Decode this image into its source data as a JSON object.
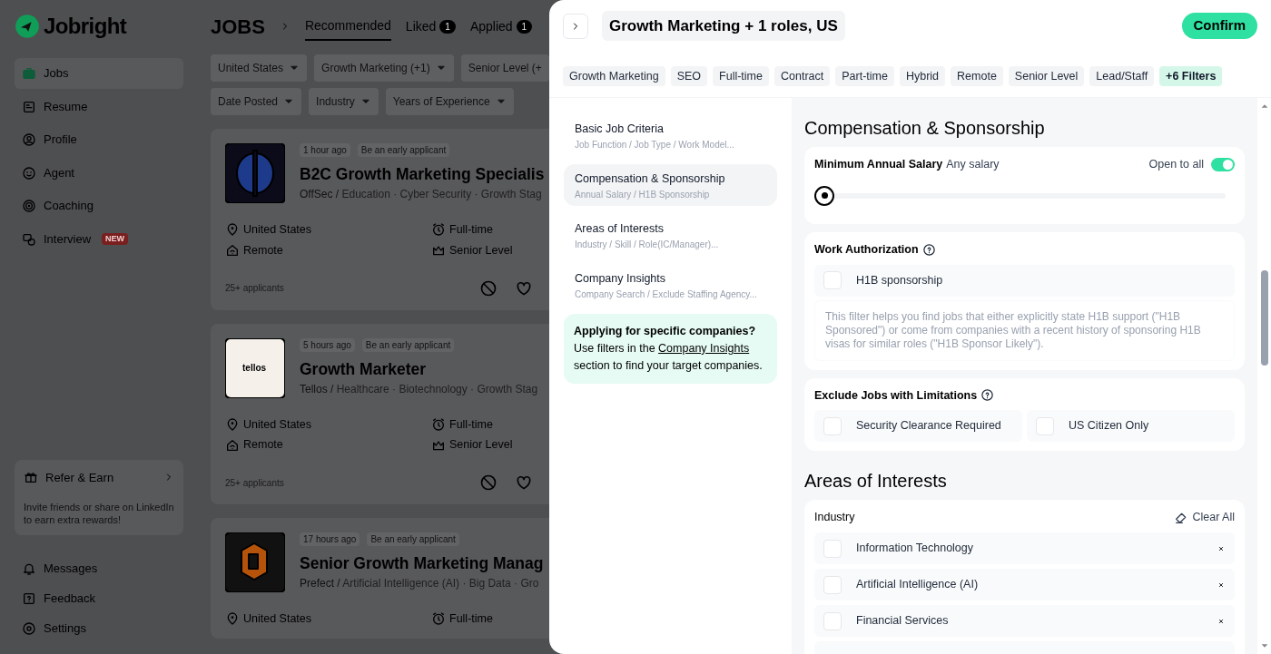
{
  "app": {
    "logo": "Jobright"
  },
  "sidebar": {
    "items": [
      {
        "label": "Jobs",
        "selected": true
      },
      {
        "label": "Resume",
        "selected": false
      },
      {
        "label": "Profile",
        "selected": false
      },
      {
        "label": "Agent",
        "selected": false
      },
      {
        "label": "Coaching",
        "selected": false
      },
      {
        "label": "Interview",
        "selected": false,
        "badge": "NEW"
      }
    ],
    "refer": {
      "title": "Refer & Earn",
      "text": "Invite friends or share on LinkedIn to earn extra rewards!"
    },
    "bottom_items": [
      "Messages",
      "Feedback",
      "Settings"
    ]
  },
  "header": {
    "title": "JOBS",
    "tabs": [
      {
        "label": "Recommended",
        "selected": true
      },
      {
        "label": "Liked",
        "selected": false,
        "count": "1"
      },
      {
        "label": "Applied",
        "selected": false,
        "count": "1"
      }
    ]
  },
  "filter_rows": [
    [
      "United States",
      "Growth Marketing (+1)",
      "Senior Level (+"
    ],
    [
      "Date Posted",
      "Industry",
      "Years of Experience"
    ]
  ],
  "jobs": [
    {
      "posted": "1 hour ago",
      "note": "Be an early applicant",
      "title": "B2C Growth Marketing Specialis",
      "company": "OffSec /",
      "industries": "Education · Cyber Security · Growth Stag",
      "location": "United States",
      "job_type": "Full-time",
      "work_model": "Remote",
      "level": "Senior Level",
      "applicants": "25+ applicants",
      "liked": false
    },
    {
      "posted": "5 hours ago",
      "note": "Be an early applicant",
      "title": "Growth Marketer",
      "company": "Tellos /",
      "industries": "Healthcare · Biotechnology · Growth Stag",
      "location": "United States",
      "job_type": "Full-time",
      "work_model": "Remote",
      "level": "Senior Level",
      "applicants": "25+ applicants",
      "liked": false,
      "logo_text": "tellos"
    },
    {
      "posted": "17 hours ago",
      "note": "Be an early applicant",
      "title": "Senior Growth Marketing Manag",
      "company": "Prefect /",
      "industries": "Artificial Intelligence (AI) · Big Data · Gro",
      "location": "United States",
      "job_type": "Full-time"
    }
  ],
  "drawer": {
    "title": "Growth Marketing + 1 roles, US",
    "confirm": "Confirm",
    "chips": [
      {
        "label": "Growth Marketing",
        "kind": "filter"
      },
      {
        "label": "SEO",
        "kind": "filter"
      },
      {
        "label": "Full-time",
        "kind": "filter"
      },
      {
        "label": "Contract",
        "kind": "filter"
      },
      {
        "label": "Part-time",
        "kind": "filter"
      },
      {
        "label": "Hybrid",
        "kind": "filter"
      },
      {
        "label": "Remote",
        "kind": "filter"
      },
      {
        "label": "Senior Level",
        "kind": "filter"
      },
      {
        "label": "Lead/Staff",
        "kind": "filter"
      },
      {
        "label": "+6 Filters",
        "kind": "more"
      }
    ],
    "sections": [
      {
        "title": "Basic Job Criteria",
        "subtitle": "Job Function / Job Type / Work Model...",
        "selected": false
      },
      {
        "title": "Compensation & Sponsorship",
        "subtitle": "Annual Salary / H1B Sponsorship",
        "selected": true
      },
      {
        "title": "Areas of Interests",
        "subtitle": "Industry / Skill / Role(IC/Manager)...",
        "selected": false
      },
      {
        "title": "Company Insights",
        "subtitle": "Company Search / Exclude Staffing Agency...",
        "selected": false
      }
    ],
    "tip": {
      "title": "Applying for specific companies?",
      "before": "Use filters in the",
      "link": "Company Insights",
      "after": "section to find your target companies."
    },
    "compensation": {
      "heading": "Compensation & Sponsorship",
      "salary_label": "Minimum Annual Salary",
      "salary_value": "Any salary",
      "open_label": "Open to all",
      "open_on": true
    },
    "work_authorization": {
      "title": "Work Authorization",
      "option": {
        "label": "H1B sponsorship",
        "checked": false
      },
      "note": "This filter helps you find jobs that either explicitly state H1B support (\"H1B Sponsored\") or come from companies with a recent history of sponsoring H1B visas for similar roles (\"H1B Sponsor Likely\")."
    },
    "exclude": {
      "title": "Exclude Jobs with Limitations",
      "options": [
        {
          "label": "Security Clearance Required",
          "checked": false
        },
        {
          "label": "US Citizen Only",
          "checked": false
        }
      ]
    },
    "areas": {
      "heading": "Areas of Interests",
      "industry_label": "Industry",
      "clear": "Clear All",
      "items": [
        {
          "label": "Information Technology",
          "checked": false
        },
        {
          "label": "Artificial Intelligence (AI)",
          "checked": false
        },
        {
          "label": "Financial Services",
          "checked": false
        }
      ]
    }
  }
}
